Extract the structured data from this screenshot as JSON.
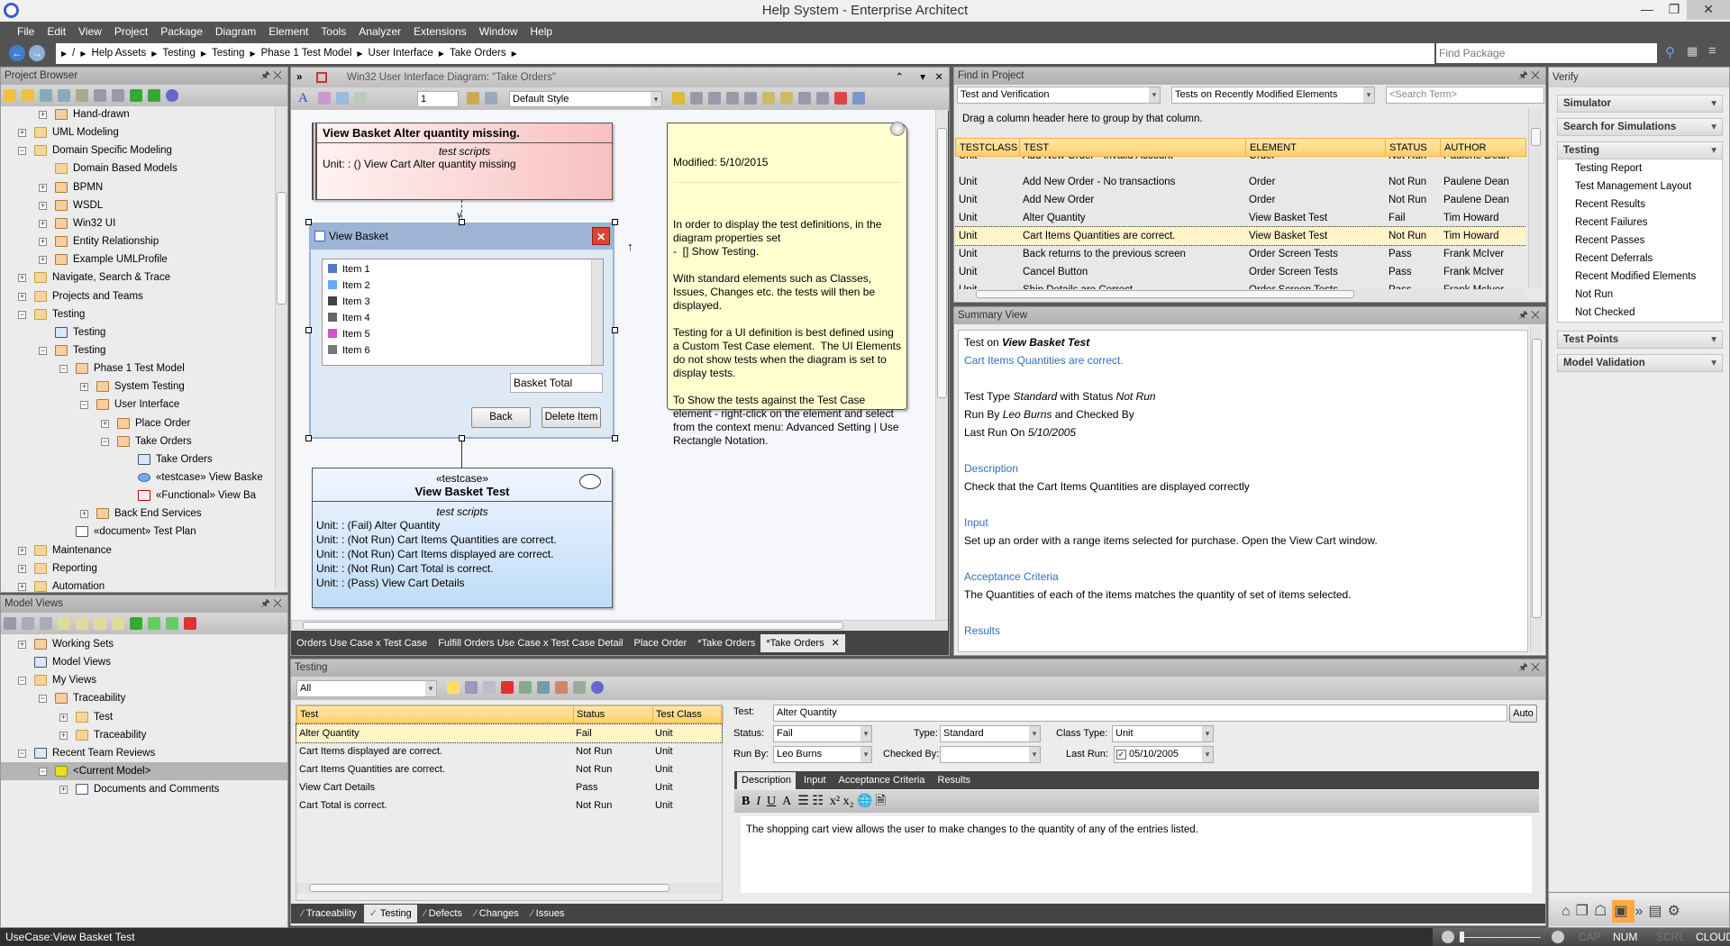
{
  "window": {
    "title": "Help System - Enterprise Architect",
    "minimize": "—",
    "maximize": "❐",
    "close": "✕"
  },
  "menu": [
    "File",
    "Edit",
    "View",
    "Project",
    "Package",
    "Diagram",
    "Element",
    "Tools",
    "Analyzer",
    "Extensions",
    "Window",
    "Help"
  ],
  "breadcrumb": [
    "/",
    "Help Assets",
    "Testing",
    "Testing",
    "Phase 1 Test Model",
    "User Interface",
    "Take Orders"
  ],
  "find_package": {
    "placeholder": "Find Package"
  },
  "project_browser": {
    "title": "Project Browser",
    "items": [
      {
        "label": "Hand-drawn",
        "level": 2,
        "exp": "+",
        "icon": "folder"
      },
      {
        "label": "UML Modeling",
        "level": 1,
        "exp": "+",
        "icon": "package"
      },
      {
        "label": "Domain Specific Modeling",
        "level": 1,
        "exp": "-",
        "icon": "package"
      },
      {
        "label": "Domain Based Models",
        "level": 2,
        "exp": "",
        "icon": "package"
      },
      {
        "label": "BPMN",
        "level": 2,
        "exp": "+",
        "icon": "folder"
      },
      {
        "label": "WSDL",
        "level": 2,
        "exp": "+",
        "icon": "folder"
      },
      {
        "label": "Win32 UI",
        "level": 2,
        "exp": "+",
        "icon": "folder"
      },
      {
        "label": "Entity Relationship",
        "level": 2,
        "exp": "+",
        "icon": "folder"
      },
      {
        "label": "Example UMLProfile",
        "level": 2,
        "exp": "+",
        "icon": "folder"
      },
      {
        "label": "Navigate, Search & Trace",
        "level": 1,
        "exp": "+",
        "icon": "package"
      },
      {
        "label": "Projects and Teams",
        "level": 1,
        "exp": "+",
        "icon": "package"
      },
      {
        "label": "Testing",
        "level": 1,
        "exp": "-",
        "icon": "package"
      },
      {
        "label": "Testing",
        "level": 2,
        "exp": "",
        "icon": "diagram"
      },
      {
        "label": "Testing",
        "level": 2,
        "exp": "-",
        "icon": "folder"
      },
      {
        "label": "Phase 1 Test Model",
        "level": 3,
        "exp": "-",
        "icon": "folder"
      },
      {
        "label": "System Testing",
        "level": 4,
        "exp": "+",
        "icon": "folder"
      },
      {
        "label": "User Interface",
        "level": 4,
        "exp": "-",
        "icon": "folder"
      },
      {
        "label": "Place Order",
        "level": 5,
        "exp": "+",
        "icon": "folder"
      },
      {
        "label": "Take Orders",
        "level": 5,
        "exp": "-",
        "icon": "folder"
      },
      {
        "label": "Take Orders",
        "level": 6,
        "exp": "",
        "icon": "diagram"
      },
      {
        "label": "«testcase» View Baske",
        "level": 6,
        "exp": "",
        "icon": "testcase"
      },
      {
        "label": "«Functional» View Ba",
        "level": 6,
        "exp": "",
        "icon": "functional"
      },
      {
        "label": "Back End Services",
        "level": 4,
        "exp": "+",
        "icon": "folder"
      },
      {
        "label": "«document» Test Plan",
        "level": 3,
        "exp": "",
        "icon": "document"
      },
      {
        "label": "Maintenance",
        "level": 1,
        "exp": "+",
        "icon": "package"
      },
      {
        "label": "Reporting",
        "level": 1,
        "exp": "+",
        "icon": "package"
      },
      {
        "label": "Automation",
        "level": 1,
        "exp": "+",
        "icon": "package"
      }
    ]
  },
  "model_views": {
    "title": "Model Views",
    "items": [
      {
        "label": "Working Sets",
        "level": 1,
        "exp": "+",
        "icon": "folder"
      },
      {
        "label": "Model Views",
        "level": 1,
        "exp": "",
        "icon": "diagram"
      },
      {
        "label": "My Views",
        "level": 1,
        "exp": "-",
        "icon": "package"
      },
      {
        "label": "Traceability",
        "level": 2,
        "exp": "-",
        "icon": "folder"
      },
      {
        "label": "Test",
        "level": 3,
        "exp": "+",
        "icon": "package"
      },
      {
        "label": "Traceability",
        "level": 3,
        "exp": "+",
        "icon": "package"
      },
      {
        "label": "Recent Team Reviews",
        "level": 1,
        "exp": "-",
        "icon": "diagram"
      },
      {
        "label": "<Current Model>",
        "level": 2,
        "exp": "-",
        "icon": "db",
        "selected": true
      },
      {
        "label": "Documents and Comments",
        "level": 3,
        "exp": "+",
        "icon": "document"
      }
    ]
  },
  "diagram": {
    "title": "Win32 User Interface Diagram: \"Take Orders\"",
    "style": "Default Style",
    "line_width": "1",
    "issue_box": {
      "title": "View Basket Alter quantity missing.",
      "section": "test scripts",
      "line": "Unit: : () View Cart Alter quantity missing"
    },
    "view_basket": {
      "title": "View Basket",
      "items": [
        "Item 1",
        "Item 2",
        "Item 3",
        "Item 4",
        "Item 5",
        "Item 6"
      ],
      "basket_total": "Basket Total",
      "back": "Back",
      "delete": "Delete Item"
    },
    "note": {
      "modified": "Modified: 5/10/2015",
      "body": "In order to display the test definitions, in the diagram properties set\n-  [] Show Testing.\n\nWith standard elements such as Classes, Issues, Changes etc. the tests will then be displayed.\n\nTesting for a UI definition is best defined using a Custom Test Case element.  The UI Elements do not show tests when the diagram is set to display tests.\n\nTo Show the tests against the Test Case element - right-click on the element and select from the context menu: Advanced Setting | Use Rectangle Notation."
    },
    "testcase": {
      "stereotype": "«testcase»",
      "name": "View Basket Test",
      "section": "test scripts",
      "lines": [
        "Unit: : (Fail) Alter Quantity",
        "Unit: : (Not Run) Cart Items Quantities are correct.",
        "Unit: : (Not Run) Cart Items displayed are correct.",
        "Unit: : (Not Run) Cart Total is correct.",
        "Unit: : (Pass) View Cart Details"
      ]
    },
    "tabs": [
      "Orders Use Case x Test Case",
      "Fulfill Orders Use Case x Test Case Detail",
      "Place Order",
      "*Take Orders",
      "*Take Orders"
    ],
    "active_tab": 4
  },
  "find": {
    "title": "Find in Project",
    "category": "Test and Verification",
    "search": "Tests on Recently Modified Elements",
    "term_placeholder": "<Search Term>",
    "group_hint": "Drag a column header here to group by that column.",
    "columns": [
      "TESTCLASS",
      "TEST",
      "ELEMENT",
      "STATUS",
      "AUTHOR"
    ],
    "rows": [
      [
        "Unit",
        "Add New Order - Invalid Account",
        "Order",
        "Not Run",
        "Paulene Dean"
      ],
      [
        "Unit",
        "Add New Order - No transactions",
        "Order",
        "Not Run",
        "Paulene Dean"
      ],
      [
        "Unit",
        "Add New Order",
        "Order",
        "Not Run",
        "Paulene Dean"
      ],
      [
        "Unit",
        "Alter Quantity",
        "View Basket Test",
        "Fail",
        "Tim Howard"
      ],
      [
        "Unit",
        "Cart Items Quantities are correct.",
        "View Basket Test",
        "Not Run",
        "Tim Howard"
      ],
      [
        "Unit",
        "Back returns to the previous screen",
        "Order Screen Tests",
        "Pass",
        "Frank McIver"
      ],
      [
        "Unit",
        "Cancel Button",
        "Order Screen Tests",
        "Pass",
        "Frank McIver"
      ],
      [
        "Unit",
        "Ship Details are Correct",
        "Order Screen Tests",
        "Pass",
        "Frank McIver"
      ]
    ],
    "selected_row": 4
  },
  "summary": {
    "title": "Summary View",
    "test_on": "Test on",
    "element": "View Basket Test",
    "test_name": "Cart Items Quantities are correct.",
    "type_prefix": "Test Type",
    "type": "Standard",
    "status_prefix": "with Status",
    "status": "Not Run",
    "run_prefix": "Run By",
    "run_by": "Leo Burns",
    "checked_prefix": "and Checked By",
    "last_run_prefix": "Last Run On",
    "last_run": "5/10/2005",
    "description_heading": "Description",
    "description": "Check that the Cart Items Quantities are displayed correctly",
    "input_heading": "Input",
    "input": "Set up an order with a range items selected for purchase. Open the View Cart window.",
    "acceptance_heading": "Acceptance Criteria",
    "acceptance": "The Quantities of each of the items matches the quantity of set of items selected.",
    "results_heading": "Results"
  },
  "testing": {
    "title": "Testing",
    "filter": "All",
    "columns": [
      "Test",
      "Status",
      "Test Class"
    ],
    "rows": [
      [
        "Alter Quantity",
        "Fail",
        "Unit"
      ],
      [
        "Cart Items displayed are correct.",
        "Not Run",
        "Unit"
      ],
      [
        "Cart Items Quantities are correct.",
        "Not Run",
        "Unit"
      ],
      [
        "View Cart Details",
        "Pass",
        "Unit"
      ],
      [
        "Cart Total is correct.",
        "Not Run",
        "Unit"
      ]
    ],
    "selected_row": 0,
    "form": {
      "test_label": "Test:",
      "test": "Alter Quantity",
      "auto": "Auto",
      "status_label": "Status:",
      "status": "Fail",
      "type_label": "Type:",
      "type": "Standard",
      "class_label": "Class Type:",
      "class": "Unit",
      "runby_label": "Run By:",
      "run_by": "Leo Burns",
      "checked_label": "Checked By:",
      "checked_by": "",
      "lastrun_label": "Last Run:",
      "last_run": "05/10/2005",
      "last_run_checked": true
    },
    "detail_tabs": [
      "Description",
      "Input",
      "Acceptance Criteria",
      "Results"
    ],
    "description": "The shopping cart view allows the user to make changes to the quantity of any of the entries listed.",
    "bottom_tabs": [
      "Traceability",
      "Testing",
      "Defects",
      "Changes",
      "Issues"
    ],
    "active_bottom_tab": 1
  },
  "verify": {
    "title": "Verify",
    "sections": {
      "simulator": "Simulator",
      "search_sim": "Search for Simulations",
      "testing": "Testing",
      "test_points": "Test Points",
      "model_validation": "Model Validation"
    },
    "testing_items": [
      "Testing Report",
      "Test Management Layout",
      "Recent Results",
      "Recent Failures",
      "Recent Passes",
      "Recent Deferrals",
      "Recent Modified Elements",
      "Not Run",
      "Not Checked"
    ]
  },
  "status": {
    "text": "UseCase:View Basket Test",
    "cap": "CAP",
    "num": "NUM",
    "scrl": "SCRL",
    "cloud": "CLOUD"
  },
  "colors": {
    "accent": "#ffa940",
    "header": "#ffd16e",
    "link": "#3070c0",
    "menubar": "#535353"
  }
}
